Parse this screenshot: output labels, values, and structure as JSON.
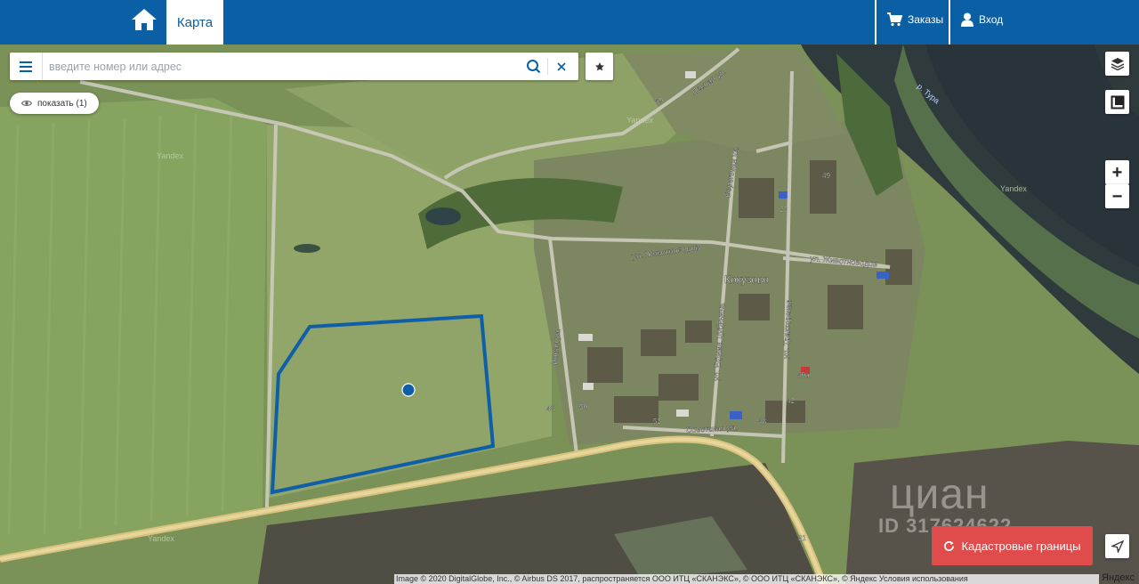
{
  "header": {
    "tab_map_label": "Карта",
    "orders_label": "Заказы",
    "login_label": "Вход"
  },
  "search": {
    "placeholder": "введите номер или адрес",
    "value": ""
  },
  "show_pill": {
    "label": "показать (1)"
  },
  "map": {
    "village_label": "Кокузово",
    "river_label": "р. Тура",
    "street_labels": {
      "zhivotnovodov_1": "ул. Животноводов",
      "zhivotnovodov_2": "ул. Животноводов",
      "sovetskaya": "Советская ул.",
      "novaya": "Новая ул.",
      "efima_dubinina": "ул. Ефима Дубинина",
      "traktorskaya": "ул. Тракторская",
      "beregovaya": "Береговая ул.",
      "lesnaya": "Лесная ул."
    },
    "house_numbers": [
      "49",
      "49",
      "23",
      "48",
      "50",
      "52",
      "40а",
      "42",
      "48",
      "21"
    ],
    "tile_brand": "Yandex",
    "plot": {
      "selected": true
    }
  },
  "controls": {
    "zoom_in": "+",
    "zoom_out": "−"
  },
  "cadastral_button": {
    "label": "Кадастровые границы"
  },
  "watermark": {
    "text": "циан",
    "id": "ID 317624622"
  },
  "copyright": {
    "text": "Image © 2020 DigitalGlobe, Inc., © Airbus DS 2017, распространяется ООО ИТЦ «СКАНЭКС», © ООО ИТЦ «СКАНЭКС», © Яндекс Условия использования",
    "brand": "Яндекс"
  },
  "colors": {
    "brand_blue": "#0b5fa5",
    "plot_outline": "#0f5fa8",
    "cadastral_red": "#e04b4b"
  }
}
